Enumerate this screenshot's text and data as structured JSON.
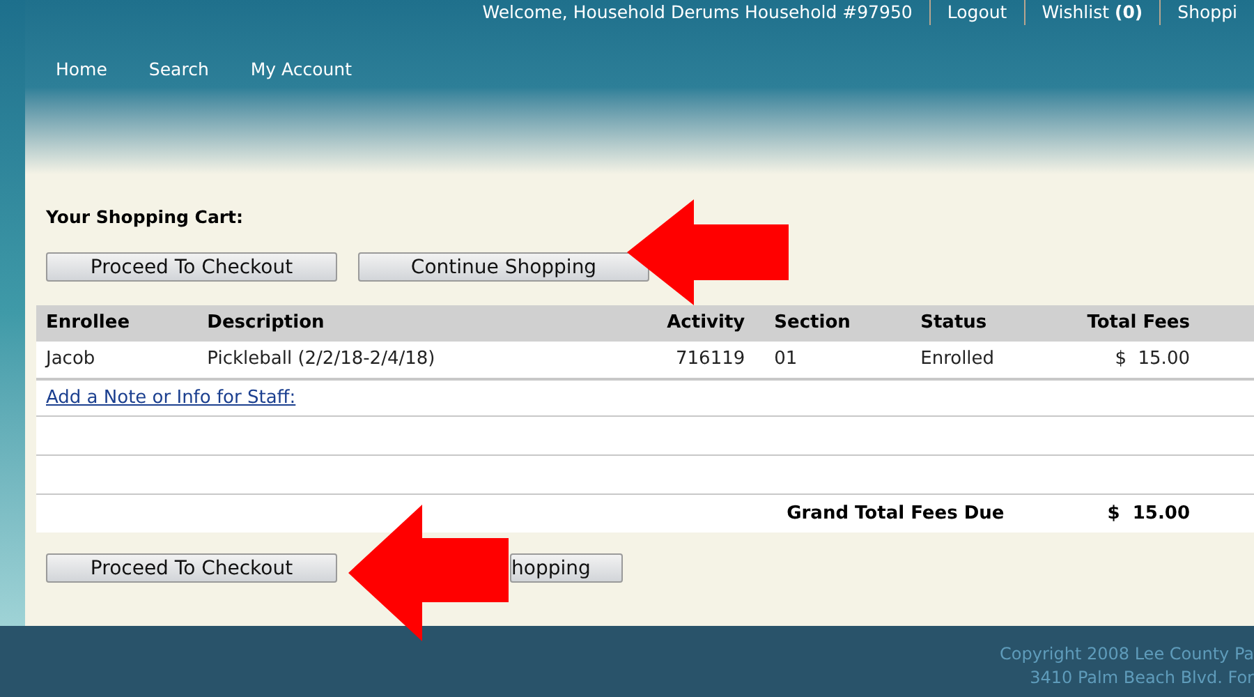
{
  "top_links": [
    {
      "text": "Welcome, Household Derums Household #97950",
      "kind": "text"
    },
    {
      "text": "Logout",
      "kind": "link"
    },
    {
      "text": "Wishlist **(0)**",
      "kind": "link"
    },
    {
      "text": "Shoppi",
      "kind": "link"
    }
  ],
  "nav": [
    "Home",
    "Search",
    "My Account"
  ],
  "cart_title": "Your Shopping Cart:",
  "top_buttons": [
    "Proceed To Checkout",
    "Continue Shopping"
  ],
  "table": {
    "columns": [
      "Enrollee",
      "Description",
      "Activity",
      "Section",
      "Status",
      "Total Fees"
    ],
    "rows": [
      [
        "Jacob",
        "Pickleball (2/2/18-2/4/18)",
        "716119",
        "01",
        "Enrolled",
        "$  15.00"
      ]
    ],
    "note_link": "Add a Note or Info for Staff:",
    "grand_total_label": "Grand Total Fees Due",
    "grand_total": "$  15.00"
  },
  "bottom_buttons": [
    "Proceed To Checkout",
    "hopping"
  ],
  "footer": [
    "Copyright 2008 Lee County Pa",
    "3410 Palm Beach Blvd. For"
  ]
}
